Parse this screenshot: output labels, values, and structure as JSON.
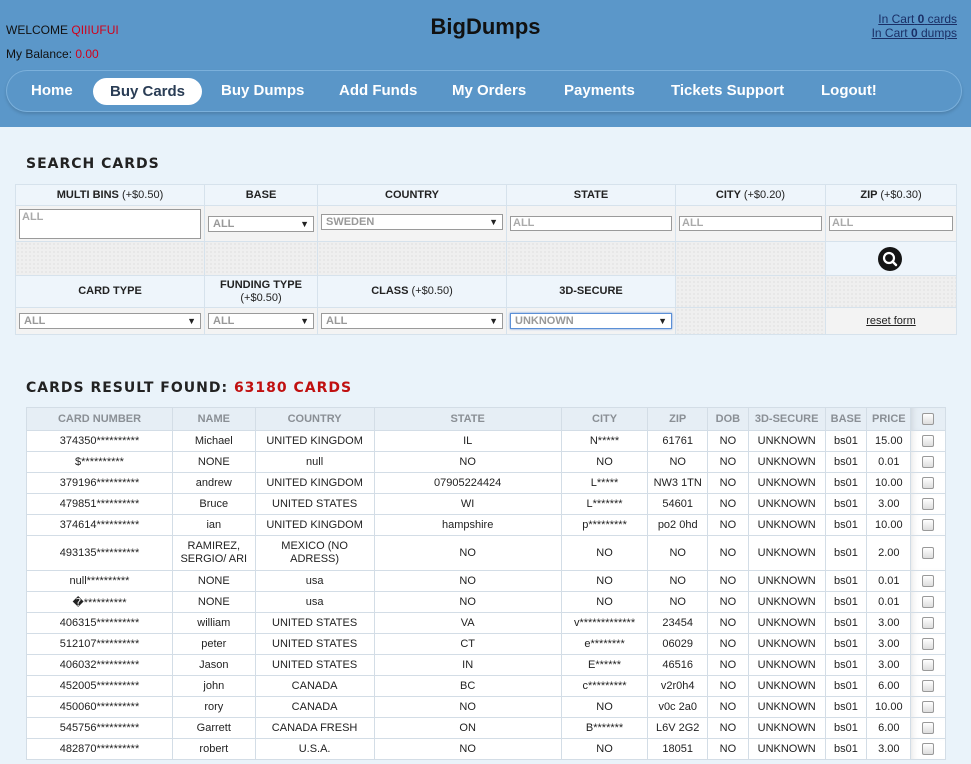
{
  "header": {
    "welcome_label": "WELCOME",
    "username": "QIIIUFUI",
    "balance_label": "My Balance:",
    "balance_value": "0.00",
    "site_title": "BigDumps",
    "cart_cards_prefix": "In Cart",
    "cart_cards_count": "0",
    "cart_cards_suffix": "cards",
    "cart_dumps_prefix": "In Cart",
    "cart_dumps_count": "0",
    "cart_dumps_suffix": "dumps"
  },
  "nav": [
    "Home",
    "Buy Cards",
    "Buy Dumps",
    "Add Funds",
    "My Orders",
    "Payments",
    "Tickets Support",
    "Logout!"
  ],
  "search": {
    "title": "SEARCH CARDS",
    "multi_bins": {
      "label": "MULTI BINS",
      "extra": "(+$0.50)",
      "placeholder": "ALL"
    },
    "base": {
      "label": "BASE",
      "value": "ALL"
    },
    "country": {
      "label": "COUNTRY",
      "value": "SWEDEN"
    },
    "state": {
      "label": "STATE",
      "placeholder": "ALL"
    },
    "city": {
      "label": "CITY",
      "extra": "(+$0.20)",
      "placeholder": "ALL"
    },
    "zip": {
      "label": "ZIP",
      "extra": "(+$0.30)",
      "placeholder": "ALL"
    },
    "card_type": {
      "label": "CARD TYPE",
      "value": "ALL"
    },
    "funding_type": {
      "label": "FUNDING TYPE",
      "extra": "(+$0.50)",
      "value": "ALL"
    },
    "class": {
      "label": "CLASS",
      "extra": "(+$0.50)",
      "value": "ALL"
    },
    "secure": {
      "label": "3D-SECURE",
      "value": "UNKNOWN"
    },
    "reset_label": "reset form"
  },
  "results": {
    "title": "CARDS RESULT FOUND:",
    "count": "63180 CARDS",
    "columns": [
      "CARD NUMBER",
      "NAME",
      "COUNTRY",
      "STATE",
      "CITY",
      "ZIP",
      "DOB",
      "3D-SECURE",
      "BASE",
      "PRICE"
    ],
    "rows": [
      [
        "374350**********",
        "Michael",
        "UNITED KINGDOM",
        "IL",
        "N*****",
        "61761",
        "NO",
        "UNKNOWN",
        "bs01",
        "15.00"
      ],
      [
        "$**********",
        "NONE",
        "null",
        "NO",
        "NO",
        "NO",
        "NO",
        "UNKNOWN",
        "bs01",
        "0.01"
      ],
      [
        "379196**********",
        "andrew",
        "UNITED KINGDOM",
        "07905224424",
        "L*****",
        "NW3 1TN",
        "NO",
        "UNKNOWN",
        "bs01",
        "10.00"
      ],
      [
        "479851**********",
        "Bruce",
        "UNITED STATES",
        "WI",
        "L*******",
        "54601",
        "NO",
        "UNKNOWN",
        "bs01",
        "3.00"
      ],
      [
        "374614**********",
        "ian",
        "UNITED KINGDOM",
        "hampshire",
        "p*********",
        "po2 0hd",
        "NO",
        "UNKNOWN",
        "bs01",
        "10.00"
      ],
      [
        "493135**********",
        "RAMIREZ, SERGIO/ ARI",
        "MEXICO (NO ADRESS)",
        "NO",
        "NO",
        "NO",
        "NO",
        "UNKNOWN",
        "bs01",
        "2.00"
      ],
      [
        "null**********",
        "NONE",
        "usa",
        "NO",
        "NO",
        "NO",
        "NO",
        "UNKNOWN",
        "bs01",
        "0.01"
      ],
      [
        "�**********",
        "NONE",
        "usa",
        "NO",
        "NO",
        "NO",
        "NO",
        "UNKNOWN",
        "bs01",
        "0.01"
      ],
      [
        "406315**********",
        "william",
        "UNITED STATES",
        "VA",
        "v*************",
        "23454",
        "NO",
        "UNKNOWN",
        "bs01",
        "3.00"
      ],
      [
        "512107**********",
        "peter",
        "UNITED STATES",
        "CT",
        "e********",
        "06029",
        "NO",
        "UNKNOWN",
        "bs01",
        "3.00"
      ],
      [
        "406032**********",
        "Jason",
        "UNITED STATES",
        "IN",
        "E******",
        "46516",
        "NO",
        "UNKNOWN",
        "bs01",
        "3.00"
      ],
      [
        "452005**********",
        "john",
        "CANADA",
        "BC",
        "c*********",
        "v2r0h4",
        "NO",
        "UNKNOWN",
        "bs01",
        "6.00"
      ],
      [
        "450060**********",
        "rory",
        "CANADA",
        "NO",
        "NO",
        "v0c 2a0",
        "NO",
        "UNKNOWN",
        "bs01",
        "10.00"
      ],
      [
        "545756**********",
        "Garrett",
        "CANADA FRESH",
        "ON",
        "B*******",
        "L6V 2G2",
        "NO",
        "UNKNOWN",
        "bs01",
        "6.00"
      ],
      [
        "482870**********",
        "robert",
        "U.S.A.",
        "NO",
        "NO",
        "18051",
        "NO",
        "UNKNOWN",
        "bs01",
        "3.00"
      ]
    ]
  }
}
